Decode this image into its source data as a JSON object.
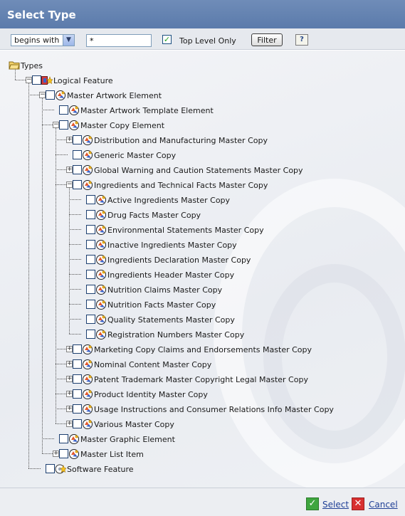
{
  "title": "Select Type",
  "toolbar": {
    "match_mode": "begins with",
    "filter_value": "*",
    "top_level_only_checked": true,
    "top_level_only_label": "Top Level Only",
    "filter_button": "Filter"
  },
  "tree": [
    {
      "label": "Types",
      "depth": 0,
      "icon": "folder-icon",
      "expander": "none",
      "checkbox": false
    },
    {
      "label": "Logical Feature",
      "depth": 1,
      "icon": "logical-feature-icon",
      "expander": "minus",
      "checkbox": true
    },
    {
      "label": "Master Artwork Element",
      "depth": 2,
      "icon": "master-element-icon",
      "expander": "minus",
      "checkbox": true
    },
    {
      "label": "Master Artwork Template Element",
      "depth": 3,
      "icon": "master-element-icon",
      "expander": "none",
      "checkbox": true
    },
    {
      "label": "Master Copy Element",
      "depth": 3,
      "icon": "master-element-icon",
      "expander": "minus",
      "checkbox": true
    },
    {
      "label": "Distribution and Manufacturing Master Copy",
      "depth": 4,
      "icon": "master-element-icon",
      "expander": "plus",
      "checkbox": true
    },
    {
      "label": "Generic Master Copy",
      "depth": 4,
      "icon": "master-element-icon",
      "expander": "none",
      "checkbox": true
    },
    {
      "label": "Global Warning and Caution Statements Master Copy",
      "depth": 4,
      "icon": "master-element-icon",
      "expander": "plus",
      "checkbox": true
    },
    {
      "label": "Ingredients and Technical Facts Master Copy",
      "depth": 4,
      "icon": "master-element-icon",
      "expander": "minus",
      "checkbox": true
    },
    {
      "label": "Active Ingredients Master Copy",
      "depth": 5,
      "icon": "master-element-icon",
      "expander": "none",
      "checkbox": true
    },
    {
      "label": "Drug Facts Master Copy",
      "depth": 5,
      "icon": "master-element-icon",
      "expander": "none",
      "checkbox": true
    },
    {
      "label": "Environmental Statements Master Copy",
      "depth": 5,
      "icon": "master-element-icon",
      "expander": "none",
      "checkbox": true
    },
    {
      "label": "Inactive Ingredients Master Copy",
      "depth": 5,
      "icon": "master-element-icon",
      "expander": "none",
      "checkbox": true
    },
    {
      "label": "Ingredients Declaration Master Copy",
      "depth": 5,
      "icon": "master-element-icon",
      "expander": "none",
      "checkbox": true
    },
    {
      "label": "Ingredients Header Master Copy",
      "depth": 5,
      "icon": "master-element-icon",
      "expander": "none",
      "checkbox": true
    },
    {
      "label": "Nutrition Claims Master Copy",
      "depth": 5,
      "icon": "master-element-icon",
      "expander": "none",
      "checkbox": true
    },
    {
      "label": "Nutrition Facts Master Copy",
      "depth": 5,
      "icon": "master-element-icon",
      "expander": "none",
      "checkbox": true
    },
    {
      "label": "Quality Statements Master Copy",
      "depth": 5,
      "icon": "master-element-icon",
      "expander": "none",
      "checkbox": true
    },
    {
      "label": "Registration Numbers Master Copy",
      "depth": 5,
      "icon": "master-element-icon",
      "expander": "none",
      "checkbox": true
    },
    {
      "label": "Marketing Copy Claims and Endorsements Master Copy",
      "depth": 4,
      "icon": "master-element-icon",
      "expander": "plus",
      "checkbox": true
    },
    {
      "label": "Nominal Content Master Copy",
      "depth": 4,
      "icon": "master-element-icon",
      "expander": "plus",
      "checkbox": true
    },
    {
      "label": "Patent Trademark Master Copyright Legal Master Copy",
      "depth": 4,
      "icon": "master-element-icon",
      "expander": "plus",
      "checkbox": true
    },
    {
      "label": "Product Identity Master Copy",
      "depth": 4,
      "icon": "master-element-icon",
      "expander": "plus",
      "checkbox": true
    },
    {
      "label": "Usage Instructions and Consumer Relations Info Master Copy",
      "depth": 4,
      "icon": "master-element-icon",
      "expander": "plus",
      "checkbox": true
    },
    {
      "label": "Various Master Copy",
      "depth": 4,
      "icon": "master-element-icon",
      "expander": "plus",
      "checkbox": true
    },
    {
      "label": "Master Graphic Element",
      "depth": 3,
      "icon": "master-element-icon",
      "expander": "none",
      "checkbox": true
    },
    {
      "label": "Master List Item",
      "depth": 3,
      "icon": "master-element-icon",
      "expander": "plus",
      "checkbox": true
    },
    {
      "label": "Software Feature",
      "depth": 2,
      "icon": "software-feature-icon",
      "expander": "none",
      "checkbox": true
    }
  ],
  "footer": {
    "select_label": "Select",
    "cancel_label": "Cancel"
  },
  "colors": {
    "title_bar": "#5b7bab",
    "link": "#1f3f96"
  }
}
